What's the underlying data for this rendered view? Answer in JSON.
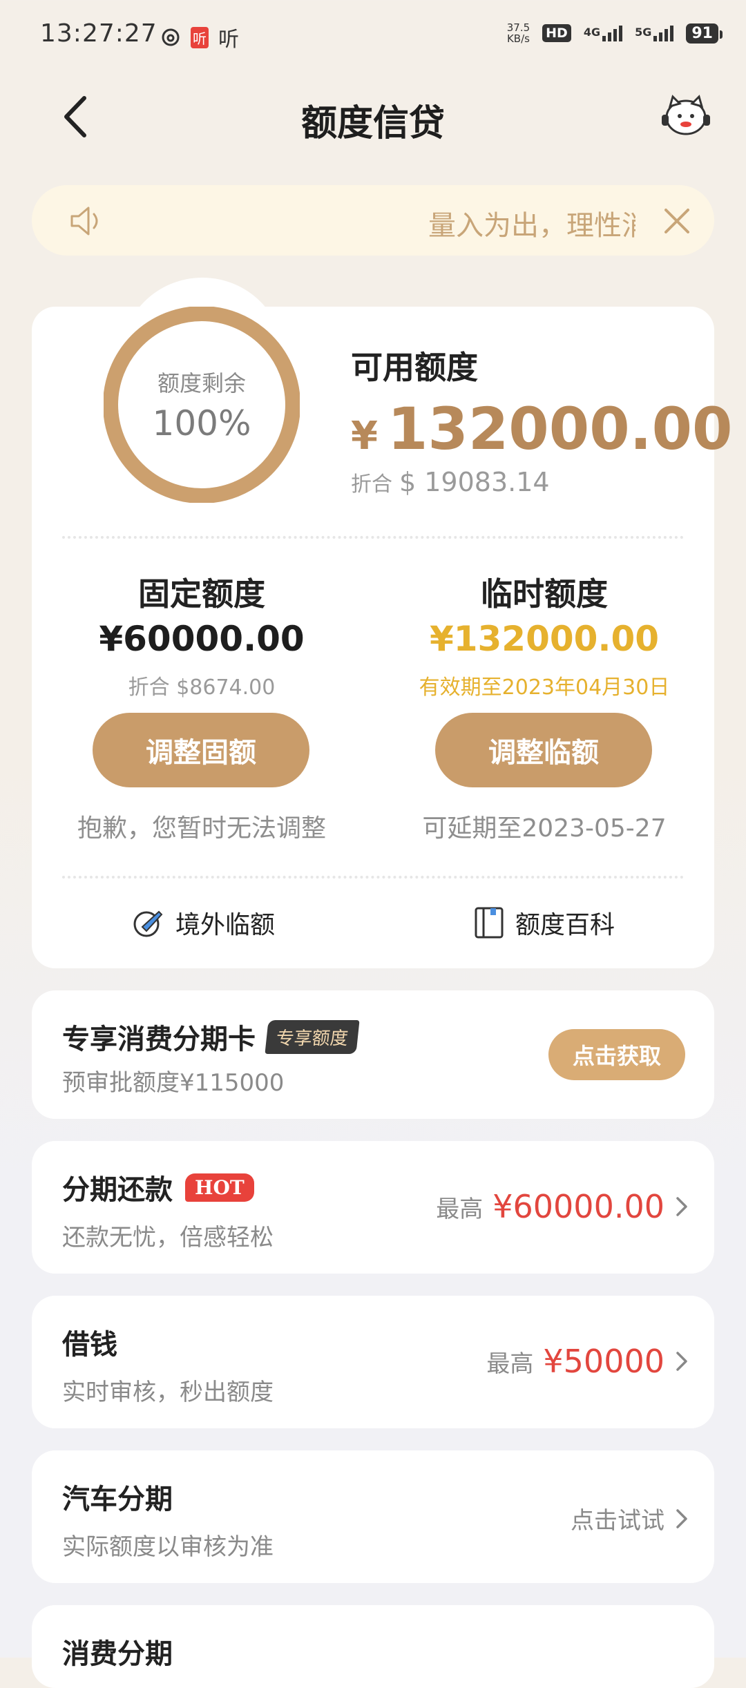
{
  "status_bar": {
    "time": "13:27:27",
    "app_badge": "听",
    "app_text": "听",
    "net_speed_value": "37.5",
    "net_speed_unit": "KB/s",
    "hd_label": "HD",
    "net_4g": "4G",
    "net_5g": "5G",
    "battery": "91"
  },
  "header": {
    "title": "额度信贷"
  },
  "notice": {
    "text": "量入为出，理性消费"
  },
  "limit_card": {
    "ring_label": "额度剩余",
    "ring_percent": "100%",
    "ring_fraction": 1.0,
    "available_label": "可用额度",
    "available_currency": "¥",
    "available_amount": "132000.00",
    "available_converted_prefix": "折合",
    "available_converted": "$ 19083.14",
    "fixed": {
      "title": "固定额度",
      "amount": "¥60000.00",
      "converted": "折合 $8674.00",
      "button": "调整固额",
      "note": "抱歉，您暂时无法调整"
    },
    "temp": {
      "title": "临时额度",
      "amount": "¥132000.00",
      "validity": "有效期至2023年04月30日",
      "button": "调整临额",
      "note": "可延期至2023-05-27"
    },
    "links": {
      "overseas": "境外临额",
      "wiki": "额度百科"
    }
  },
  "offers": {
    "installment_card": {
      "title": "专享消费分期卡",
      "badge": "专享额度",
      "sub": "预审批额度¥115000",
      "button": "点击获取"
    },
    "repay": {
      "title": "分期还款",
      "badge": "HOT",
      "sub": "还款无忧，倍感轻松",
      "max_label": "最高",
      "max_value": "¥60000.00"
    },
    "borrow": {
      "title": "借钱",
      "sub": "实时审核，秒出额度",
      "max_label": "最高",
      "max_value": "¥50000"
    },
    "car": {
      "title": "汽车分期",
      "sub": "实际额度以审核为准",
      "action": "点击试试"
    },
    "consume": {
      "title": "消费分期"
    }
  },
  "colors": {
    "gold": "#c99c6a",
    "gold_text": "#b7895a",
    "temp_amount": "#e6b12e",
    "red": "#e2463e",
    "notice_bg": "#fdf6e5"
  }
}
